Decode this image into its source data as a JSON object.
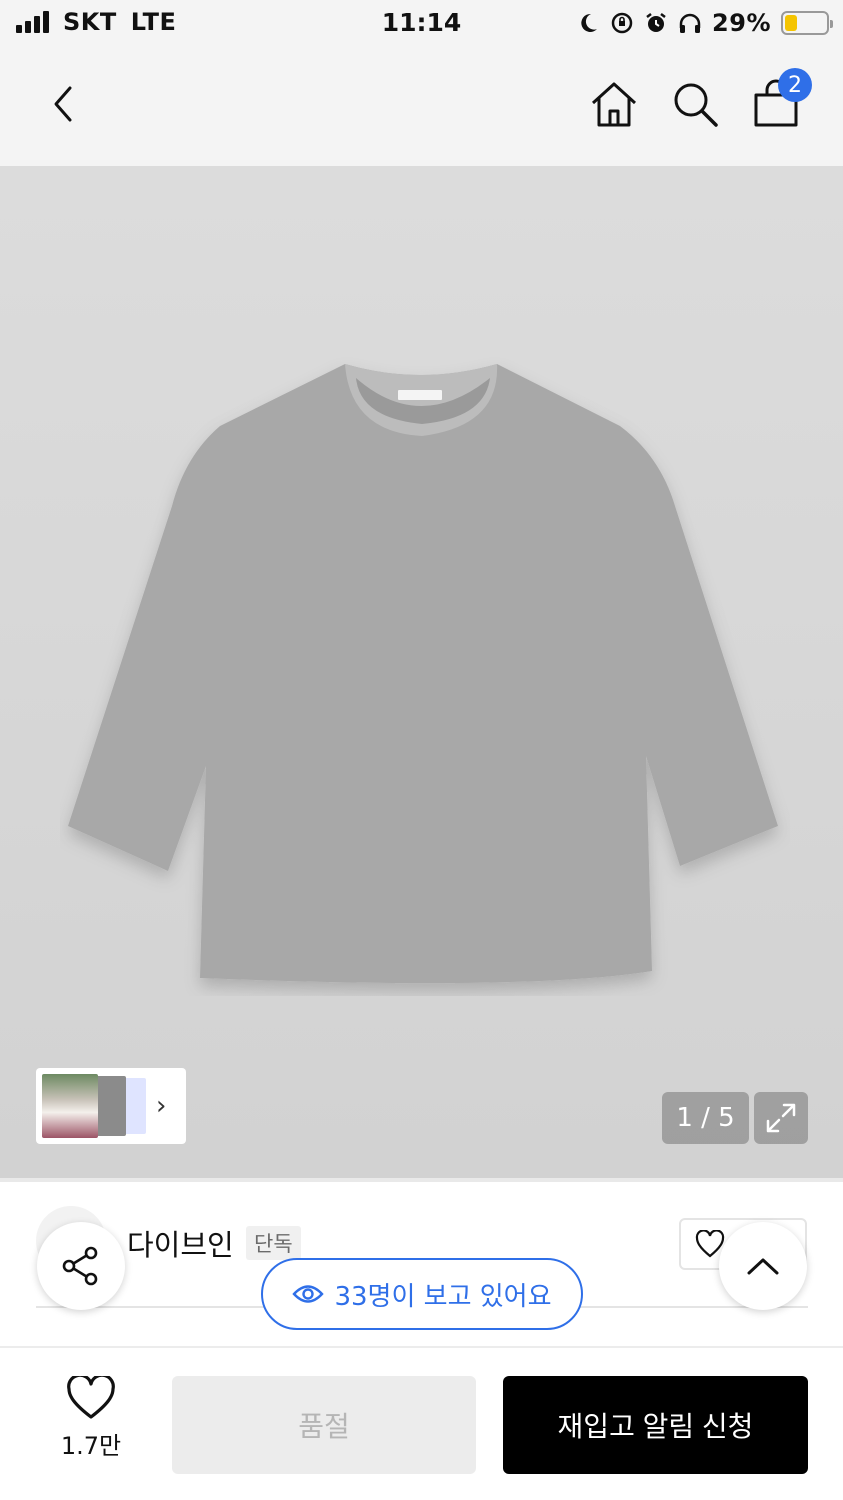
{
  "status_bar": {
    "carrier": "SKT",
    "network": "LTE",
    "time": "11:14",
    "battery_percent": "29%",
    "battery_level": 0.29,
    "icons": [
      "signal-icon",
      "moon-icon",
      "rotation-lock-icon",
      "alarm-icon",
      "headphones-icon",
      "battery-icon"
    ]
  },
  "header": {
    "back_icon": "chevron-left-icon",
    "home_icon": "home-icon",
    "search_icon": "search-icon",
    "cart_icon": "shopping-bag-icon",
    "cart_count": "2",
    "badge_color": "#2f6fe8"
  },
  "gallery": {
    "current_index": "1 / 5",
    "product_color": "#a8a8a8",
    "expand_icon": "expand-icon",
    "thumbnail_next_icon": "chevron-right-icon"
  },
  "product": {
    "brand": "다이브인",
    "badge": "단독",
    "viewers_text": "33명이 보고 있어요",
    "viewers_icon": "eye-icon",
    "share_icon": "share-icon",
    "scroll_top_icon": "chevron-up-icon"
  },
  "bottom_bar": {
    "wish_icon": "heart-icon",
    "wish_count": "1.7만",
    "soldout_label": "품절",
    "restock_label": "재입고 알림 신청"
  }
}
